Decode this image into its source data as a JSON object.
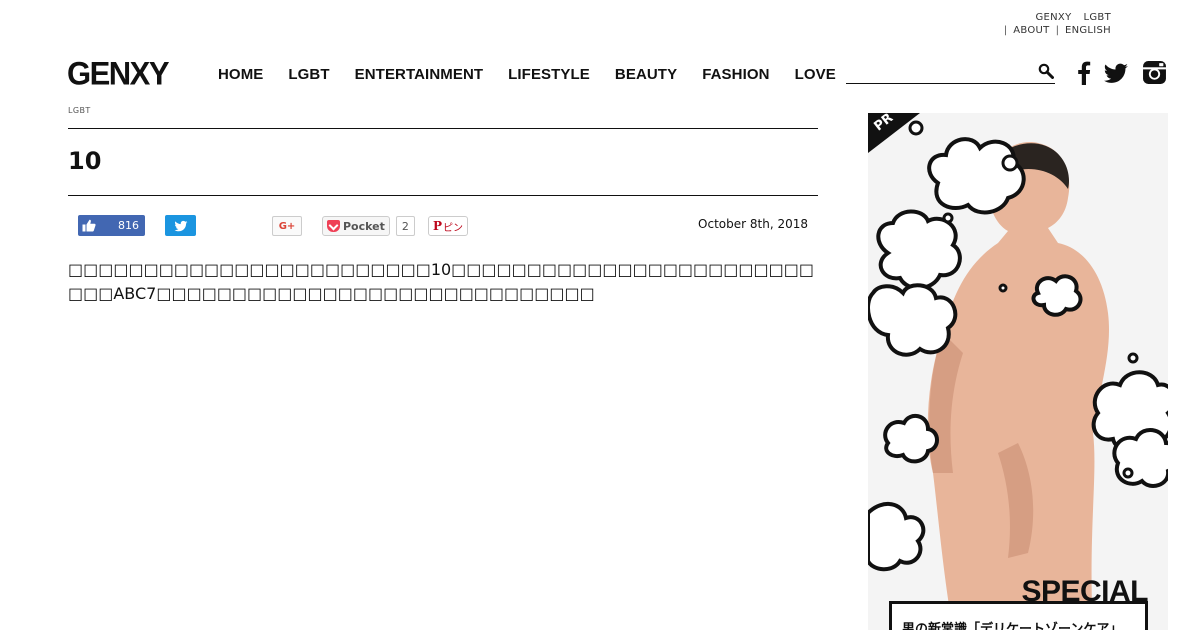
{
  "utility_links": {
    "top": [
      "GENXY",
      "LGBT"
    ],
    "bottom": [
      "ABOUT",
      "ENGLISH"
    ],
    "separator": "|"
  },
  "header": {
    "logo": "GENXY",
    "nav": [
      "HOME",
      "LGBT",
      "ENTERTAINMENT",
      "LIFESTYLE",
      "BEAUTY",
      "FASHION",
      "LOVE"
    ],
    "search": {
      "value": "",
      "placeholder": ""
    },
    "social_icons": [
      "facebook-icon",
      "twitter-icon",
      "instagram-icon"
    ]
  },
  "article": {
    "category": "LGBT",
    "title": "10",
    "date": "October 8th, 2018",
    "body": "□□□□□□□□□□□□□□□□□□□□□□□□10□□□□□□□□□□□□□□□□□□□□□□□□□□□ABC7□□□□□□□□□□□□□□□□□□□□□□□□□□□□□"
  },
  "share": {
    "facebook_like_count": "816",
    "gplus_label": "G+",
    "pocket_label": "Pocket",
    "pocket_count": "2",
    "pinterest_label": "ピン"
  },
  "ad": {
    "badge": "PR",
    "headline": "SPECIAL",
    "caption": "男の新常識「デリケートゾーンケア」"
  },
  "colors": {
    "facebook": "#4267b2",
    "twitter": "#1b95e0",
    "pocket": "#ef4056",
    "pinterest": "#bd081c"
  }
}
